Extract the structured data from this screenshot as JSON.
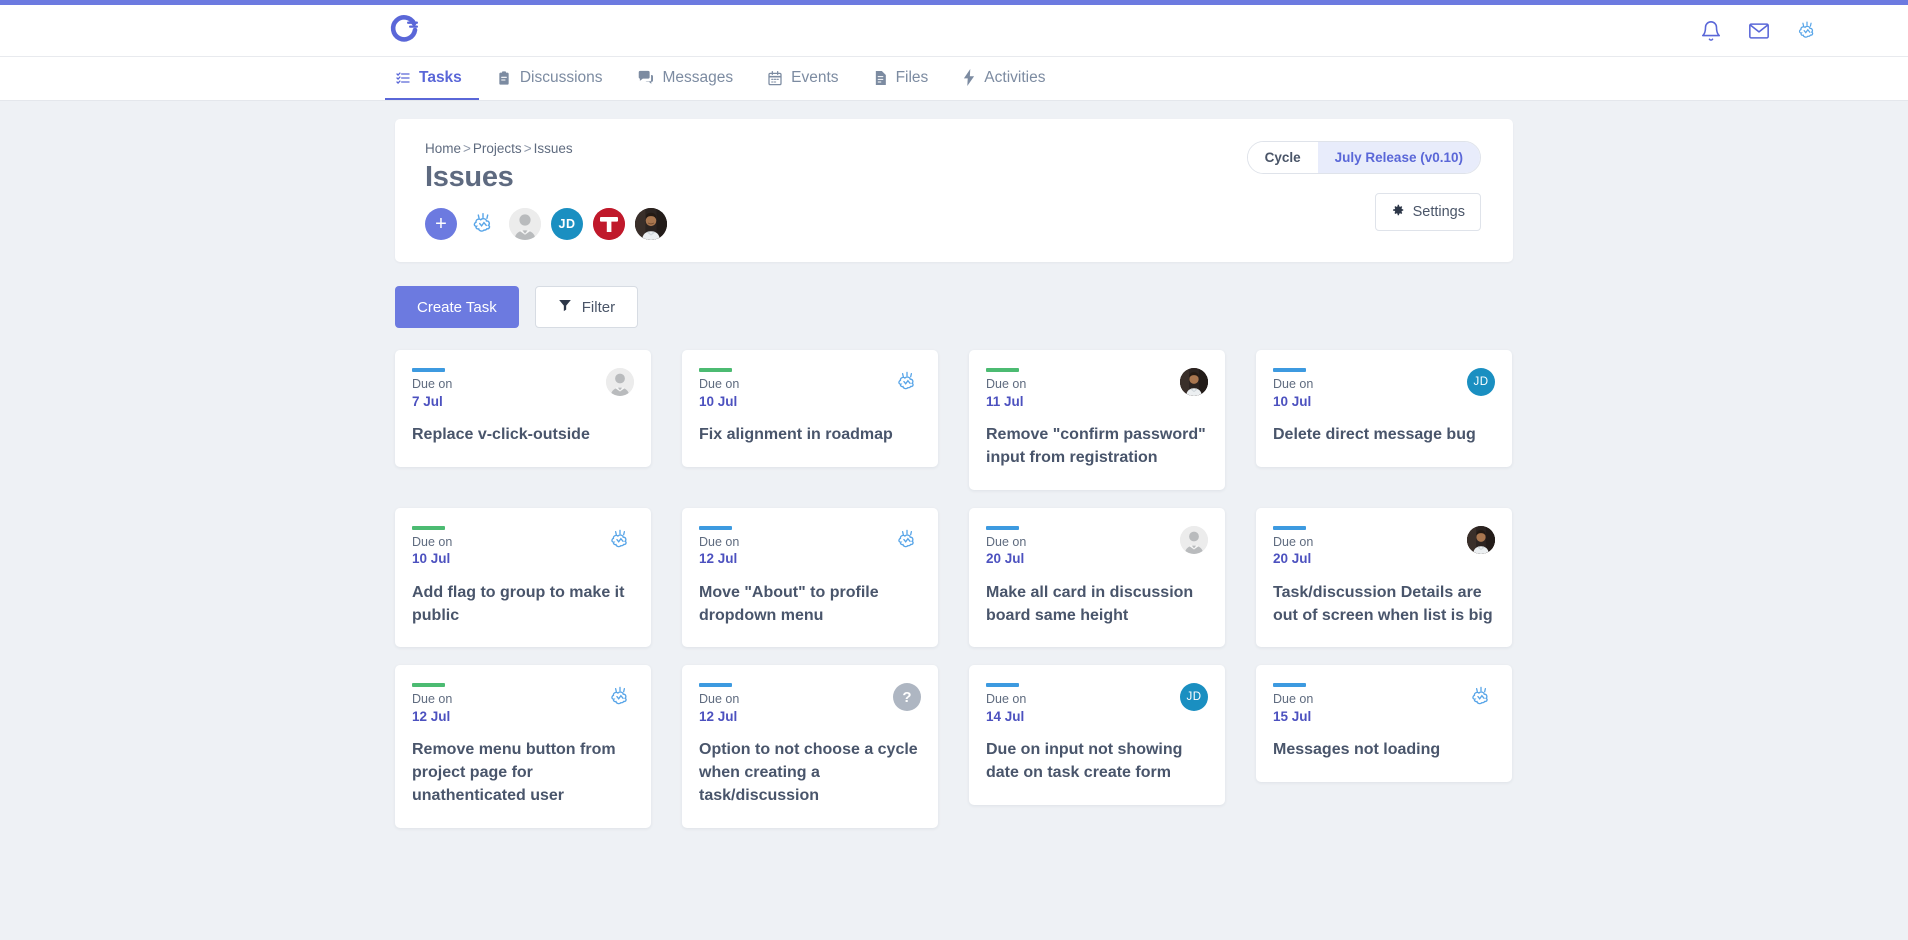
{
  "brand": {
    "logo_icon": "circular-g-logo"
  },
  "header": {
    "icons": [
      {
        "name": "notifications-bell-icon",
        "label": "Notifications"
      },
      {
        "name": "mail-envelope-icon",
        "label": "Messages"
      },
      {
        "name": "brain-avatar-icon",
        "label": "Profile"
      }
    ]
  },
  "nav": {
    "tabs": [
      {
        "label": "Tasks",
        "icon": "task-list-icon",
        "active": true
      },
      {
        "label": "Discussions",
        "icon": "clipboard-icon",
        "active": false
      },
      {
        "label": "Messages",
        "icon": "chat-bubble-icon",
        "active": false
      },
      {
        "label": "Events",
        "icon": "calendar-icon",
        "active": false
      },
      {
        "label": "Files",
        "icon": "file-icon",
        "active": false
      },
      {
        "label": "Activities",
        "icon": "lightning-icon",
        "active": false
      }
    ]
  },
  "breadcrumb": {
    "items": [
      "Home",
      "Projects",
      "Issues"
    ],
    "separator": ">"
  },
  "page": {
    "title": "Issues"
  },
  "members": [
    {
      "type": "add",
      "label": "+",
      "name": "add-member-button"
    },
    {
      "type": "brain",
      "label": "",
      "name": "member-avatar-brain"
    },
    {
      "type": "default",
      "label": "",
      "name": "member-avatar-default"
    },
    {
      "type": "jd",
      "label": "JD",
      "name": "member-avatar-jd"
    },
    {
      "type": "t",
      "label": "T",
      "name": "member-avatar-t"
    },
    {
      "type": "photo",
      "label": "",
      "name": "member-avatar-photo"
    }
  ],
  "cycle_toggle": {
    "left_label": "Cycle",
    "right_label": "July Release (v0.10)",
    "selected": "July Release (v0.10)"
  },
  "settings_button": {
    "label": "Settings",
    "icon": "gear-icon"
  },
  "actions": {
    "create_task": "Create Task",
    "filter": "Filter",
    "filter_icon": "funnel-icon"
  },
  "colors": {
    "accent": "#6c7ae0",
    "bar_blue": "#3d9ae0",
    "bar_green": "#4cbb72",
    "date_text": "#4c51bf",
    "page_bg": "#eef1f5"
  },
  "due_label": "Due on",
  "cards": [
    {
      "bar": "blue",
      "due": "7 Jul",
      "title": "Replace v-click-outside",
      "avatar": "default"
    },
    {
      "bar": "green",
      "due": "10 Jul",
      "title": "Fix alignment in roadmap",
      "avatar": "brain"
    },
    {
      "bar": "green",
      "due": "11 Jul",
      "title": "Remove \"confirm password\" input from registration",
      "avatar": "photo"
    },
    {
      "bar": "blue",
      "due": "10 Jul",
      "title": "Delete direct message bug",
      "avatar": "jd"
    },
    {
      "bar": "green",
      "due": "10 Jul",
      "title": "Add flag to group to make it public",
      "avatar": "brain"
    },
    {
      "bar": "blue",
      "due": "12 Jul",
      "title": "Move \"About\" to profile dropdown menu",
      "avatar": "brain"
    },
    {
      "bar": "blue",
      "due": "20 Jul",
      "title": "Make all card in discussion board same height",
      "avatar": "default"
    },
    {
      "bar": "blue",
      "due": "20 Jul",
      "title": "Task/discussion Details are out of screen when list is big",
      "avatar": "photo"
    },
    {
      "bar": "green",
      "due": "12 Jul",
      "title": "Remove menu button from project page for unathenticated user",
      "avatar": "brain"
    },
    {
      "bar": "blue",
      "due": "12 Jul",
      "title": "Option to not choose a cycle when creating a task/discussion",
      "avatar": "question"
    },
    {
      "bar": "blue",
      "due": "14 Jul",
      "title": "Due on input not showing date on task create form",
      "avatar": "jd"
    },
    {
      "bar": "blue",
      "due": "15 Jul",
      "title": "Messages not loading",
      "avatar": "brain"
    }
  ]
}
